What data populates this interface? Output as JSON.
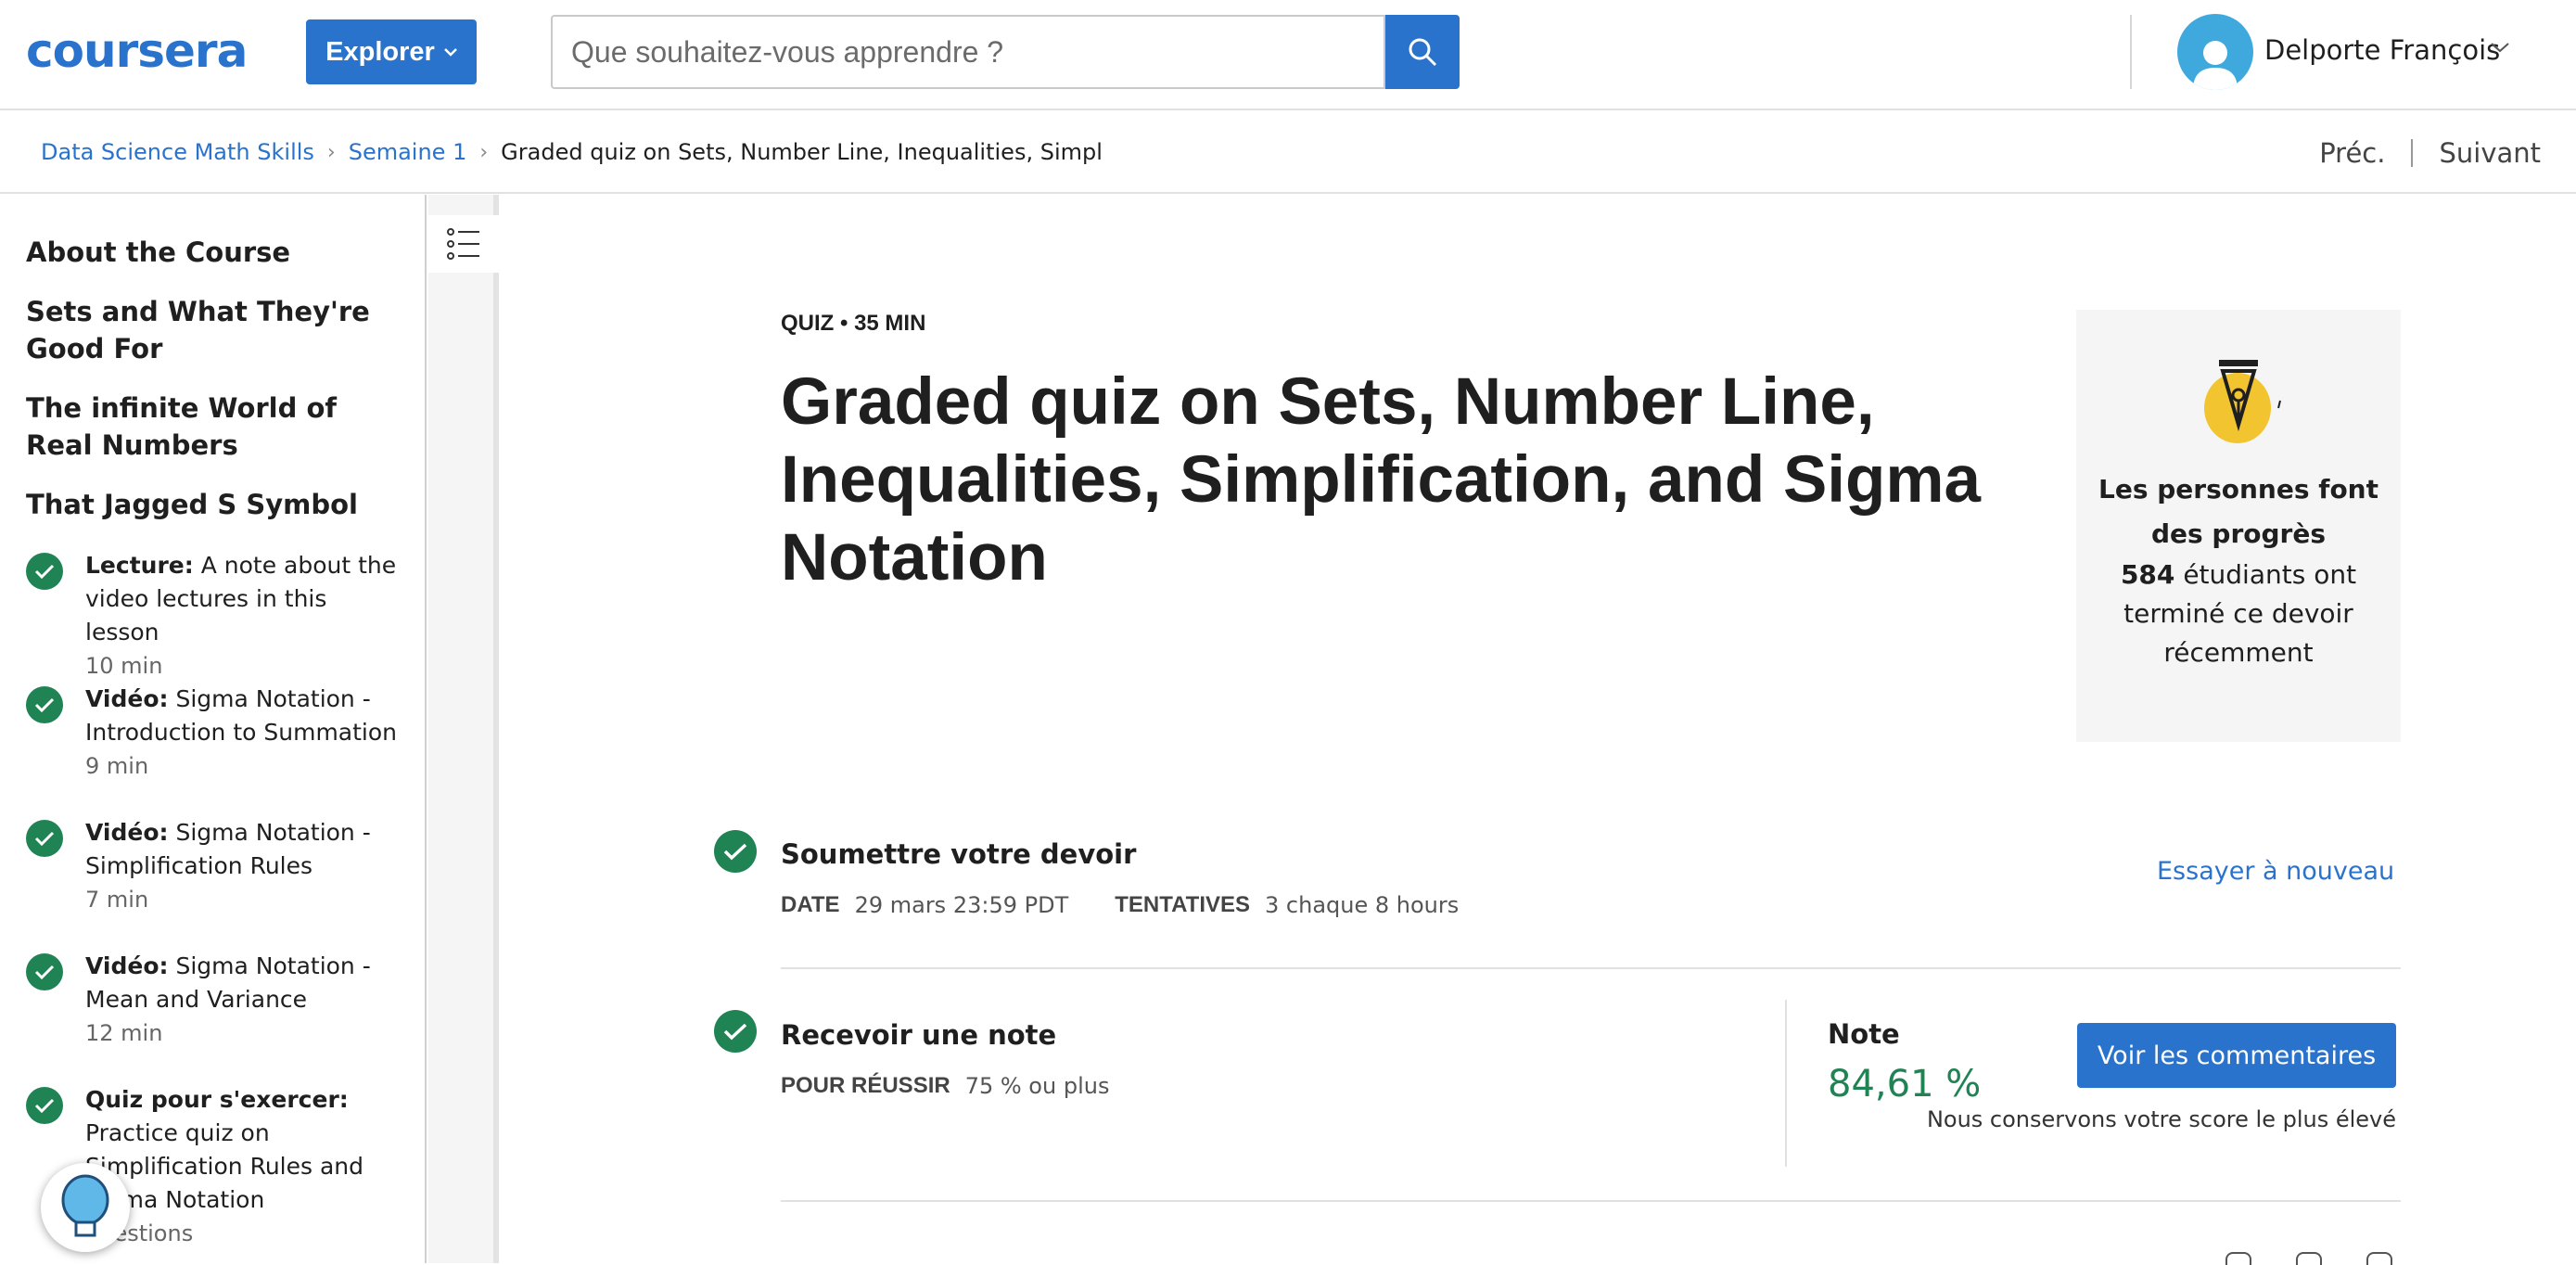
{
  "header": {
    "logo_text": "coursera",
    "explore_label": "Explorer",
    "search_placeholder": "Que souhaitez-vous apprendre ?",
    "user_name": "Delporte François",
    "brand_color": "#2a73cc"
  },
  "breadcrumb": {
    "items": [
      "Data Science Math Skills",
      "Semaine 1",
      "Graded quiz on Sets, Number Line, Inequalities, Simpl"
    ],
    "prev_label": "Préc.",
    "next_label": "Suivant"
  },
  "sidebar": {
    "sections": [
      "About the Course",
      "Sets and What They're Good For",
      "The infinite World of Real Numbers",
      "That Jagged S Symbol"
    ],
    "items": [
      {
        "kind": "Lecture:",
        "title": "A note about the video lectures in this lesson",
        "duration": "10  min"
      },
      {
        "kind": "Vidéo:",
        "title": "Sigma Notation - Introduction to Summation",
        "duration": "9  min"
      },
      {
        "kind": "Vidéo:",
        "title": "Sigma Notation - Simplification Rules",
        "duration": "7  min"
      },
      {
        "kind": "Vidéo:",
        "title": "Sigma Notation - Mean and Variance",
        "duration": "12  min"
      },
      {
        "kind": "Quiz pour s'exercer:",
        "title": "Practice quiz on Simplification Rules and Sigma Notation",
        "duration": "questions"
      }
    ]
  },
  "main": {
    "meta": "QUIZ • 35  MIN",
    "title": "Graded quiz on Sets, Number Line, Inequalities, Simplification, and Sigma Notation",
    "progress_card": {
      "heading": "Les personnes font des progrès",
      "count": "584",
      "body": "étudiants ont terminé ce devoir récemment"
    },
    "submit": {
      "title": "Soumettre votre devoir",
      "date_key": "DATE",
      "date_val": "29 mars 23:59 PDT",
      "attempts_key": "TENTATIVES",
      "attempts_val": "3 chaque 8  hours",
      "retry_label": "Essayer à nouveau"
    },
    "grade": {
      "title": "Recevoir une note",
      "pass_key": "POUR RÉUSSIR",
      "pass_val": "75 % ou plus",
      "note_label": "Note",
      "note_value": "84,61 %",
      "comments_label": "Voir les commentaires",
      "keep_score": "Nous conservons votre score le plus élevé"
    }
  }
}
